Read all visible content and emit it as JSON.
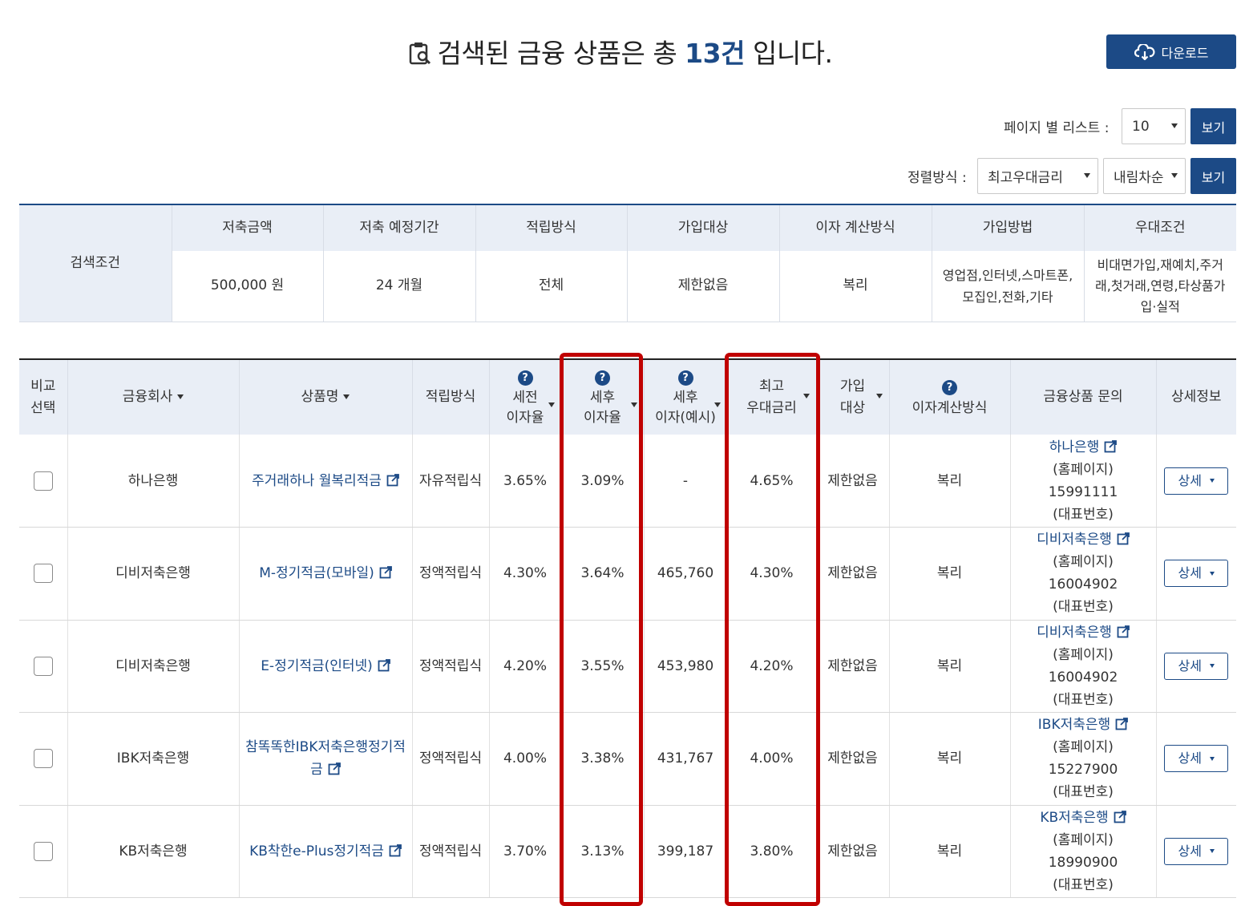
{
  "headline": {
    "prefix": "검색된 금융 상품은 총 ",
    "count": "13건",
    "suffix": " 입니다."
  },
  "download_label": "다운로드",
  "page_size": {
    "label": "페이지 별 리스트 :",
    "value": "10",
    "button": "보기"
  },
  "sort": {
    "label": "정렬방식 :",
    "field": "최고우대금리",
    "order": "내림차순",
    "button": "보기"
  },
  "conditions": {
    "label": "검색조건",
    "headers": [
      "저축금액",
      "저축 예정기간",
      "적립방식",
      "가입대상",
      "이자 계산방식",
      "가입방법",
      "우대조건"
    ],
    "values": [
      "500,000 원",
      "24 개월",
      "전체",
      "제한없음",
      "복리",
      "영업점,인터넷,스마트폰,\n모집인,전화,기타",
      "비대면가입,재예치,주거\n래,첫거래,연령,타상품가\n입·실적"
    ]
  },
  "results": {
    "headers": {
      "compare": "비교\n선택",
      "company": "금융회사",
      "product": "상품명",
      "method": "적립방식",
      "pre_tax": "세전\n이자율",
      "post_tax": "세후\n이자율",
      "post_interest": "세후\n이자(예시)",
      "max_rate": "최고\n우대금리",
      "target": "가입\n대상",
      "calc": "이자계산방식",
      "inquiry": "금융상품 문의",
      "detail": "상세정보"
    },
    "detail_label": "상세",
    "rows": [
      {
        "company": "하나은행",
        "product": "주거래하나 월복리적금",
        "method": "자유적립식",
        "pre_tax": "3.65%",
        "post_tax": "3.09%",
        "post_interest": "-",
        "max_rate": "4.65%",
        "target": "제한없음",
        "calc": "복리",
        "inq_bank": "하나은행",
        "inq_home": "(홈페이지)",
        "inq_phone": "15991111",
        "inq_rep": "(대표번호)"
      },
      {
        "company": "디비저축은행",
        "product": "M-정기적금(모바일)",
        "method": "정액적립식",
        "pre_tax": "4.30%",
        "post_tax": "3.64%",
        "post_interest": "465,760",
        "max_rate": "4.30%",
        "target": "제한없음",
        "calc": "복리",
        "inq_bank": "디비저축은행",
        "inq_home": "(홈페이지)",
        "inq_phone": "16004902",
        "inq_rep": "(대표번호)"
      },
      {
        "company": "디비저축은행",
        "product": "E-정기적금(인터넷)",
        "method": "정액적립식",
        "pre_tax": "4.20%",
        "post_tax": "3.55%",
        "post_interest": "453,980",
        "max_rate": "4.20%",
        "target": "제한없음",
        "calc": "복리",
        "inq_bank": "디비저축은행",
        "inq_home": "(홈페이지)",
        "inq_phone": "16004902",
        "inq_rep": "(대표번호)"
      },
      {
        "company": "IBK저축은행",
        "product": "참똑똑한IBK저축은행정기적금",
        "method": "정액적립식",
        "pre_tax": "4.00%",
        "post_tax": "3.38%",
        "post_interest": "431,767",
        "max_rate": "4.00%",
        "target": "제한없음",
        "calc": "복리",
        "inq_bank": "IBK저축은행",
        "inq_home": "(홈페이지)",
        "inq_phone": "15227900",
        "inq_rep": "(대표번호)"
      },
      {
        "company": "KB저축은행",
        "product": "KB착한e-Plus정기적금",
        "method": "정액적립식",
        "pre_tax": "3.70%",
        "post_tax": "3.13%",
        "post_interest": "399,187",
        "max_rate": "3.80%",
        "target": "제한없음",
        "calc": "복리",
        "inq_bank": "KB저축은행",
        "inq_home": "(홈페이지)",
        "inq_phone": "18990900",
        "inq_rep": "(대표번호)"
      }
    ]
  },
  "icons": [
    "clipboard-search-icon",
    "cloud-download-icon",
    "help-icon",
    "external-link-icon",
    "sort-caret-icon"
  ],
  "colors": {
    "primary": "#1c4a86",
    "header_bg": "#e9eef6",
    "highlight": "#c00000"
  }
}
